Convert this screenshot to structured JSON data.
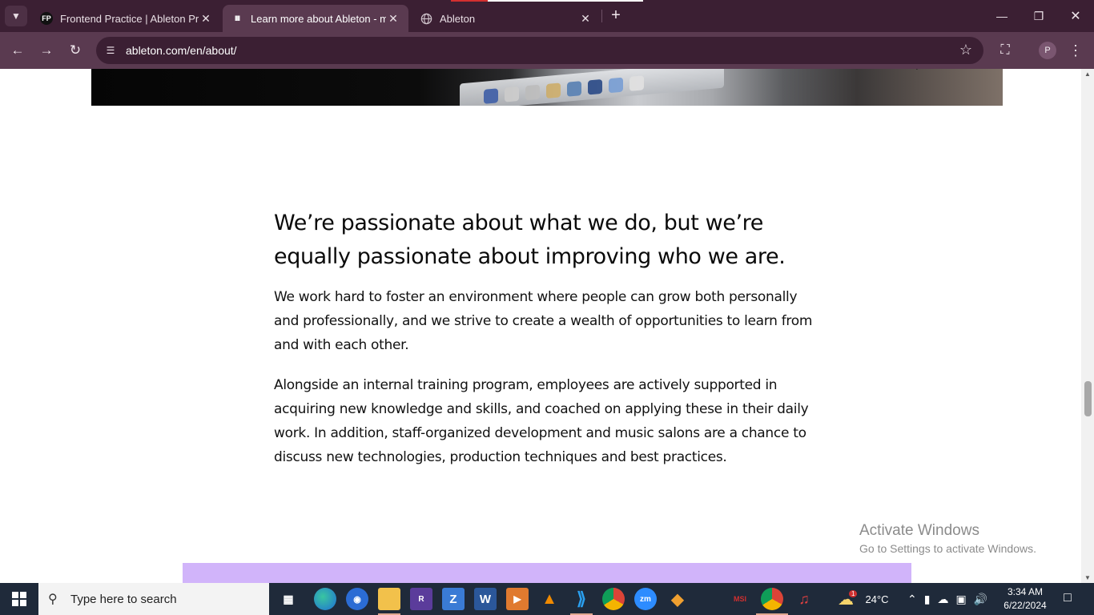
{
  "browser": {
    "tabs": [
      {
        "favicon": "FP",
        "title": "Frontend Practice | Ableton Pro",
        "active": false
      },
      {
        "favicon": "IIII",
        "title": "Learn more about Ableton - ma",
        "active": true
      },
      {
        "favicon": "globe",
        "title": "Ableton",
        "active": false
      }
    ],
    "url": "ableton.com/en/about/",
    "profile_initial": "P"
  },
  "page": {
    "heading": "We’re passionate about what we do, but we’re equally passionate about improving who we are.",
    "paragraph1": "We work hard to foster an environment where people can grow both personally and professionally, and we strive to create a wealth of opportunities to learn from and with each other.",
    "paragraph2": "Alongside an internal training program, employees are actively supported in acquiring new knowledge and skills, and coached on applying these in their daily work. In addition, staff-organized development and music salons are a chance to discuss new technologies, production techniques and best practices.",
    "band_color": "#d1b4fa"
  },
  "watermark": {
    "line1": "Activate Windows",
    "line2": "Go to Settings to activate Windows."
  },
  "taskbar": {
    "search_placeholder": "Type here to search",
    "weather_temp": "24°C",
    "weather_badge": "1",
    "time": "3:34 AM",
    "date": "6/22/2024",
    "apps": [
      "task-view",
      "edge",
      "app-blue-circle",
      "file-explorer",
      "winrar",
      "zip",
      "word",
      "media-player",
      "vlc",
      "vscode",
      "chrome",
      "zoom",
      "git",
      "msi",
      "chrome-active",
      "app-red-mic"
    ]
  },
  "colors": {
    "tabbar": "#3b1f33",
    "toolbar": "#5a3a50",
    "taskbar": "#1f2a3a"
  }
}
